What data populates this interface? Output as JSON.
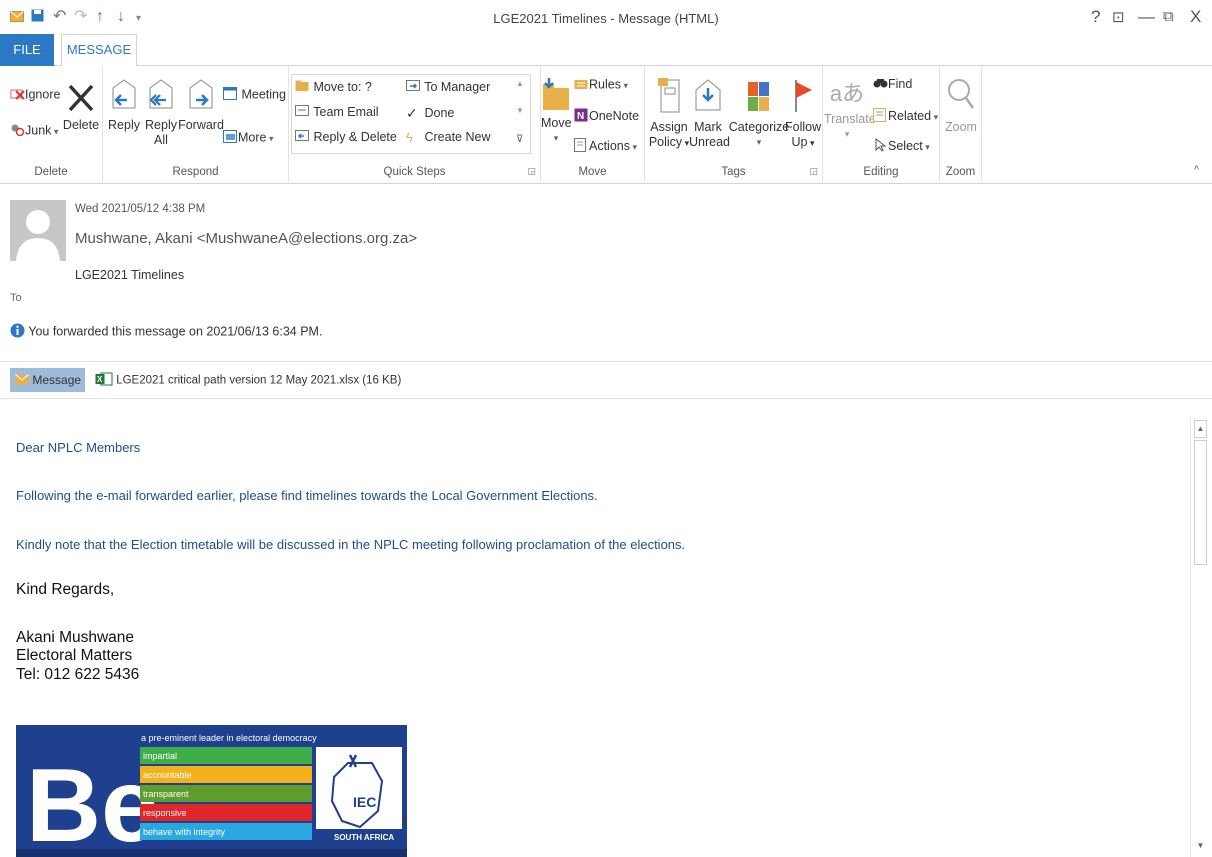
{
  "window": {
    "title": "LGE2021 Timelines - Message (HTML)",
    "controls": [
      "?",
      "⊡",
      "—",
      "⧉",
      "X"
    ]
  },
  "tabs": {
    "file": "FILE",
    "message": "MESSAGE"
  },
  "ribbon": {
    "delete_group": {
      "ignore": "Ignore",
      "junk": "Junk",
      "delete": "Delete",
      "label": "Delete"
    },
    "respond_group": {
      "reply": "Reply",
      "reply_all_1": "Reply",
      "reply_all_2": "All",
      "forward": "Forward",
      "meeting": "Meeting",
      "more": "More",
      "label": "Respond"
    },
    "quick_steps": {
      "move_to": "Move to: ?",
      "team_email": "Team Email",
      "reply_delete": "Reply & Delete",
      "to_manager": "To Manager",
      "done": "Done",
      "create_new": "Create New",
      "label": "Quick Steps"
    },
    "move_group": {
      "move": "Move",
      "rules": "Rules",
      "onenote": "OneNote",
      "actions": "Actions",
      "label": "Move"
    },
    "tags_group": {
      "assign_1": "Assign",
      "assign_2": "Policy",
      "mark_1": "Mark",
      "mark_2": "Unread",
      "categorize": "Categorize",
      "follow_1": "Follow",
      "follow_2": "Up",
      "label": "Tags"
    },
    "editing_group": {
      "translate": "Translate",
      "find": "Find",
      "related": "Related",
      "select": "Select",
      "label": "Editing"
    },
    "zoom_group": {
      "zoom": "Zoom",
      "label": "Zoom"
    }
  },
  "message": {
    "date": "Wed 2021/05/12 4:38 PM",
    "from": "Mushwane, Akani <MushwaneA@elections.org.za>",
    "subject": "LGE2021 Timelines",
    "to_label": "To",
    "info": "You forwarded this message on 2021/06/13 6:34 PM.",
    "message_tab": "Message",
    "attachment": "LGE2021 critical path version 12 May 2021.xlsx (16 KB)"
  },
  "body": {
    "greeting": "Dear NPLC Members",
    "para1": "Following the e-mail forwarded earlier, please find timelines towards the Local Government Elections.",
    "para2": "Kindly note that the Election timetable will be discussed in the NPLC meeting following proclamation of the elections.",
    "closing": "Kind Regards,",
    "sig_name": "Akani Mushwane",
    "sig_dept": "Electoral Matters",
    "sig_tel": "Tel: 012 622 5436"
  },
  "banner": {
    "tagline": "a pre-eminent leader in electoral democracy",
    "values": [
      "impartial",
      "accountable",
      "transparent",
      "responsive",
      "behave with integrity"
    ],
    "value_colors": [
      "#3fae49",
      "#f3b21b",
      "#5f9c2e",
      "#e1262a",
      "#29a8e0"
    ],
    "brand_color": "#1f3f8f",
    "big_text": "Be",
    "seal_text": "IEC",
    "country": "SOUTH AFRICA"
  }
}
